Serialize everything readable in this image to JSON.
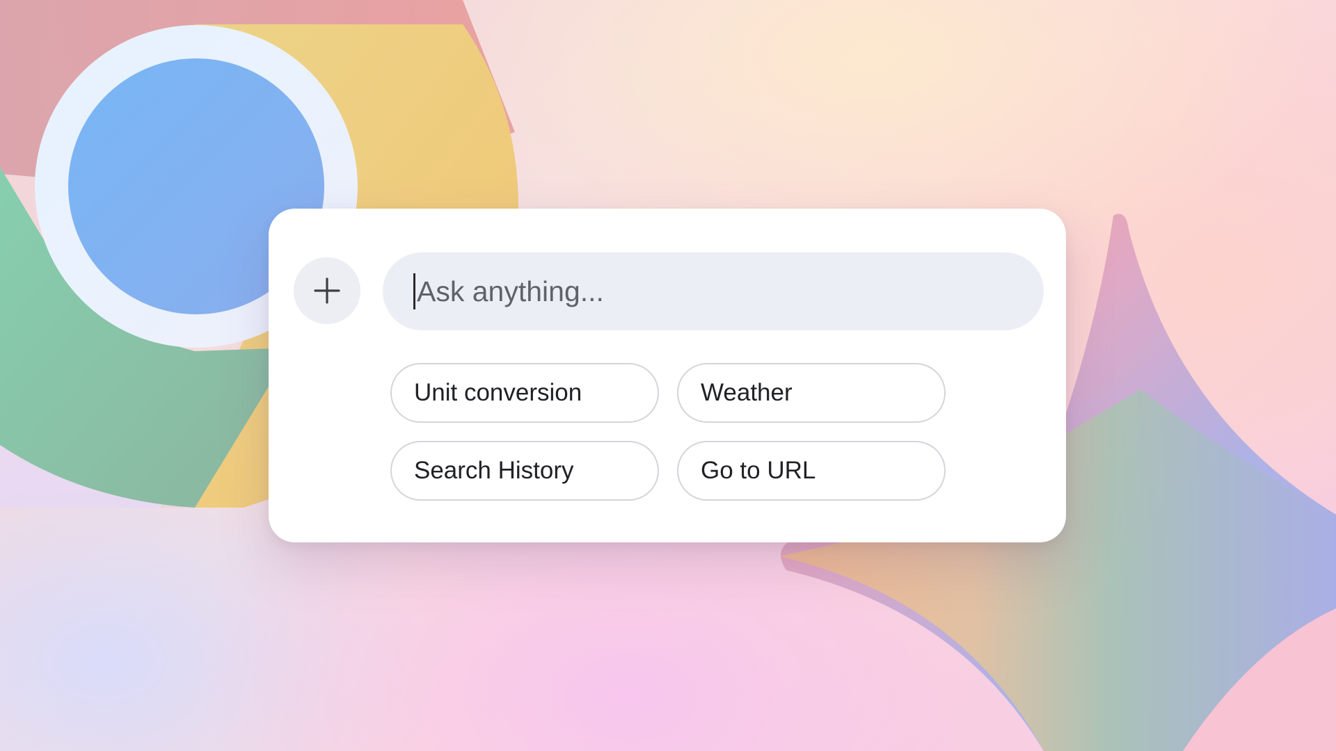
{
  "colors": {
    "card_background": "#ffffff",
    "input_background": "#eceef5",
    "chip_border": "#d3d5da",
    "text": "#202124",
    "placeholder": "#5f6368",
    "logo_blue": "#7fb4f2",
    "logo_yellow": "#eec97a",
    "logo_green": "#8cc5a4",
    "logo_red": "#e49ea0"
  },
  "composer": {
    "add_icon": "plus-icon",
    "search_placeholder": "Ask anything...",
    "search_value": ""
  },
  "suggestions": [
    {
      "label": "Unit conversion"
    },
    {
      "label": "Weather"
    },
    {
      "label": "Search History"
    },
    {
      "label": "Go to URL"
    }
  ]
}
